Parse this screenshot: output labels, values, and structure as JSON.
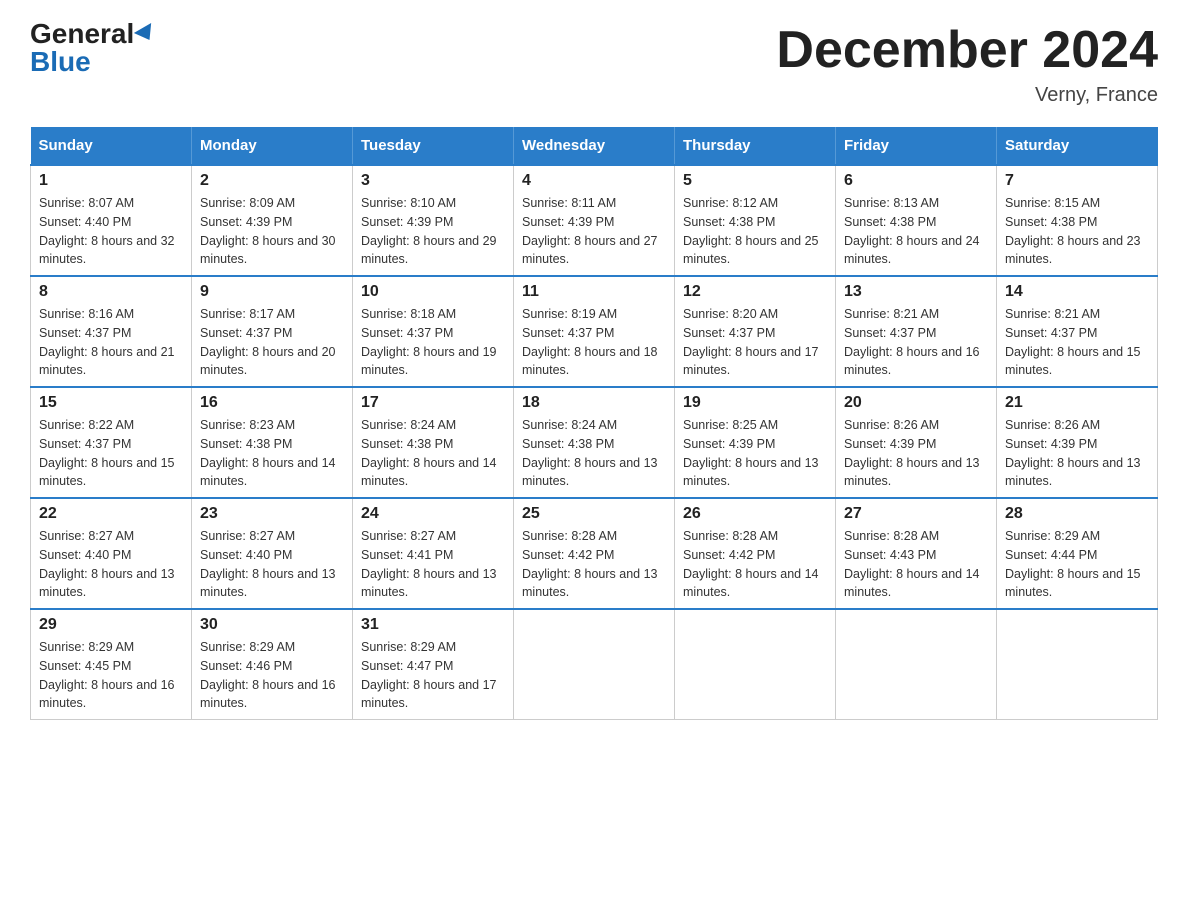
{
  "header": {
    "logo": {
      "general": "General",
      "blue": "Blue"
    },
    "title": "December 2024",
    "location": "Verny, France"
  },
  "calendar": {
    "days_of_week": [
      "Sunday",
      "Monday",
      "Tuesday",
      "Wednesday",
      "Thursday",
      "Friday",
      "Saturday"
    ],
    "weeks": [
      [
        {
          "day": "1",
          "sunrise": "8:07 AM",
          "sunset": "4:40 PM",
          "daylight": "8 hours and 32 minutes."
        },
        {
          "day": "2",
          "sunrise": "8:09 AM",
          "sunset": "4:39 PM",
          "daylight": "8 hours and 30 minutes."
        },
        {
          "day": "3",
          "sunrise": "8:10 AM",
          "sunset": "4:39 PM",
          "daylight": "8 hours and 29 minutes."
        },
        {
          "day": "4",
          "sunrise": "8:11 AM",
          "sunset": "4:39 PM",
          "daylight": "8 hours and 27 minutes."
        },
        {
          "day": "5",
          "sunrise": "8:12 AM",
          "sunset": "4:38 PM",
          "daylight": "8 hours and 25 minutes."
        },
        {
          "day": "6",
          "sunrise": "8:13 AM",
          "sunset": "4:38 PM",
          "daylight": "8 hours and 24 minutes."
        },
        {
          "day": "7",
          "sunrise": "8:15 AM",
          "sunset": "4:38 PM",
          "daylight": "8 hours and 23 minutes."
        }
      ],
      [
        {
          "day": "8",
          "sunrise": "8:16 AM",
          "sunset": "4:37 PM",
          "daylight": "8 hours and 21 minutes."
        },
        {
          "day": "9",
          "sunrise": "8:17 AM",
          "sunset": "4:37 PM",
          "daylight": "8 hours and 20 minutes."
        },
        {
          "day": "10",
          "sunrise": "8:18 AM",
          "sunset": "4:37 PM",
          "daylight": "8 hours and 19 minutes."
        },
        {
          "day": "11",
          "sunrise": "8:19 AM",
          "sunset": "4:37 PM",
          "daylight": "8 hours and 18 minutes."
        },
        {
          "day": "12",
          "sunrise": "8:20 AM",
          "sunset": "4:37 PM",
          "daylight": "8 hours and 17 minutes."
        },
        {
          "day": "13",
          "sunrise": "8:21 AM",
          "sunset": "4:37 PM",
          "daylight": "8 hours and 16 minutes."
        },
        {
          "day": "14",
          "sunrise": "8:21 AM",
          "sunset": "4:37 PM",
          "daylight": "8 hours and 15 minutes."
        }
      ],
      [
        {
          "day": "15",
          "sunrise": "8:22 AM",
          "sunset": "4:37 PM",
          "daylight": "8 hours and 15 minutes."
        },
        {
          "day": "16",
          "sunrise": "8:23 AM",
          "sunset": "4:38 PM",
          "daylight": "8 hours and 14 minutes."
        },
        {
          "day": "17",
          "sunrise": "8:24 AM",
          "sunset": "4:38 PM",
          "daylight": "8 hours and 14 minutes."
        },
        {
          "day": "18",
          "sunrise": "8:24 AM",
          "sunset": "4:38 PM",
          "daylight": "8 hours and 13 minutes."
        },
        {
          "day": "19",
          "sunrise": "8:25 AM",
          "sunset": "4:39 PM",
          "daylight": "8 hours and 13 minutes."
        },
        {
          "day": "20",
          "sunrise": "8:26 AM",
          "sunset": "4:39 PM",
          "daylight": "8 hours and 13 minutes."
        },
        {
          "day": "21",
          "sunrise": "8:26 AM",
          "sunset": "4:39 PM",
          "daylight": "8 hours and 13 minutes."
        }
      ],
      [
        {
          "day": "22",
          "sunrise": "8:27 AM",
          "sunset": "4:40 PM",
          "daylight": "8 hours and 13 minutes."
        },
        {
          "day": "23",
          "sunrise": "8:27 AM",
          "sunset": "4:40 PM",
          "daylight": "8 hours and 13 minutes."
        },
        {
          "day": "24",
          "sunrise": "8:27 AM",
          "sunset": "4:41 PM",
          "daylight": "8 hours and 13 minutes."
        },
        {
          "day": "25",
          "sunrise": "8:28 AM",
          "sunset": "4:42 PM",
          "daylight": "8 hours and 13 minutes."
        },
        {
          "day": "26",
          "sunrise": "8:28 AM",
          "sunset": "4:42 PM",
          "daylight": "8 hours and 14 minutes."
        },
        {
          "day": "27",
          "sunrise": "8:28 AM",
          "sunset": "4:43 PM",
          "daylight": "8 hours and 14 minutes."
        },
        {
          "day": "28",
          "sunrise": "8:29 AM",
          "sunset": "4:44 PM",
          "daylight": "8 hours and 15 minutes."
        }
      ],
      [
        {
          "day": "29",
          "sunrise": "8:29 AM",
          "sunset": "4:45 PM",
          "daylight": "8 hours and 16 minutes."
        },
        {
          "day": "30",
          "sunrise": "8:29 AM",
          "sunset": "4:46 PM",
          "daylight": "8 hours and 16 minutes."
        },
        {
          "day": "31",
          "sunrise": "8:29 AM",
          "sunset": "4:47 PM",
          "daylight": "8 hours and 17 minutes."
        },
        null,
        null,
        null,
        null
      ]
    ]
  }
}
